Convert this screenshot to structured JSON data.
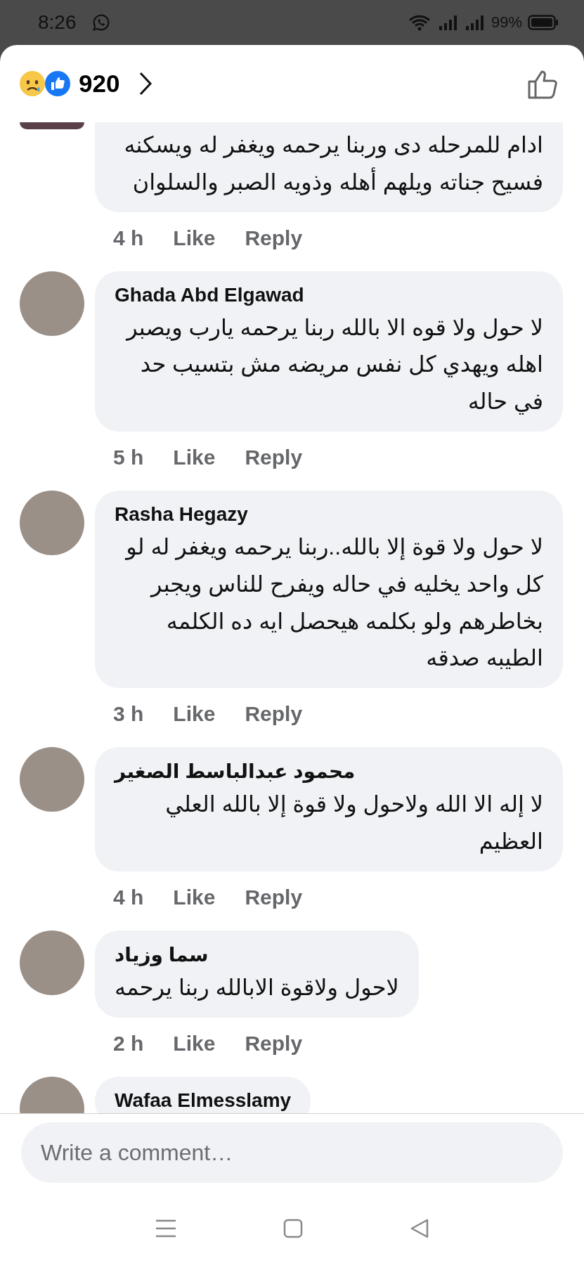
{
  "status_bar": {
    "time": "8:26",
    "battery": "99%"
  },
  "header": {
    "reaction_count": "920"
  },
  "comments": [
    {
      "text": "ادام للمرحله دى وربنا يرحمه ويغفر له ويسكنه فسيح جناته ويلهم أهله وذويه الصبر والسلوان",
      "time": "4 h",
      "like": "Like",
      "reply": "Reply"
    },
    {
      "author": "Ghada Abd Elgawad",
      "text": "لا حول ولا قوه الا بالله ربنا يرحمه يارب ويصبر اهله ويهدي كل نفس مريضه مش بتسيب حد في حاله",
      "time": "5 h",
      "like": "Like",
      "reply": "Reply"
    },
    {
      "author": "Rasha Hegazy",
      "text": "لا حول ولا قوة إلا بالله..ربنا يرحمه ويغفر له لو كل واحد يخليه في حاله ويفرح للناس ويجبر بخاطرهم ولو بكلمه هيحصل ايه ده الكلمه الطيبه صدقه",
      "time": "3 h",
      "like": "Like",
      "reply": "Reply"
    },
    {
      "author": "محمود عبدالباسط الصغير",
      "text": "لا إله الا الله ولاحول ولا قوة إلا بالله العلي العظيم",
      "time": "4 h",
      "like": "Like",
      "reply": "Reply"
    },
    {
      "author": "سما وزياد",
      "text": "لاحول ولاقوة الابالله ربنا يرحمه",
      "time": "2 h",
      "like": "Like",
      "reply": "Reply"
    },
    {
      "author": "Wafaa Elmesslamy"
    }
  ],
  "comment_box": {
    "placeholder": "Write a comment…"
  }
}
